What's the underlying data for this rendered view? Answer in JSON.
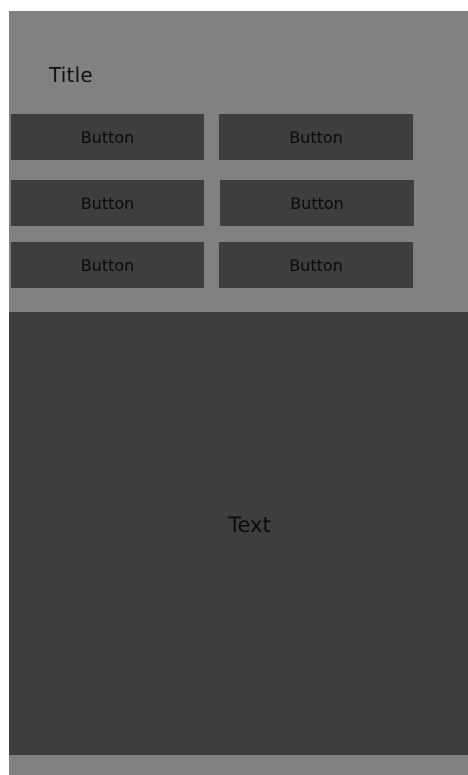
{
  "header": {
    "title": "Title"
  },
  "buttons": [
    {
      "label": "Button"
    },
    {
      "label": "Button"
    },
    {
      "label": "Button"
    },
    {
      "label": "Button"
    },
    {
      "label": "Button"
    },
    {
      "label": "Button"
    }
  ],
  "content": {
    "text": "Text"
  },
  "colors": {
    "background": "#818181",
    "dark": "#3e3e3e",
    "text": "#0a0a0a"
  }
}
